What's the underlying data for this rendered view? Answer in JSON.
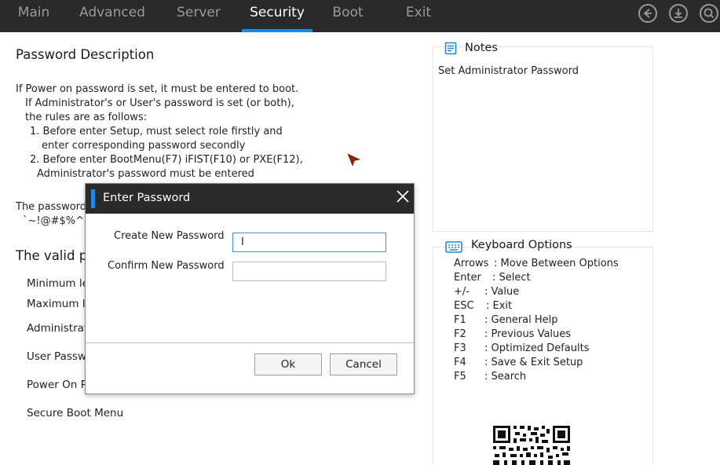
{
  "tabs": [
    {
      "label": "Main"
    },
    {
      "label": "Advanced"
    },
    {
      "label": "Server"
    },
    {
      "label": "Security"
    },
    {
      "label": "Boot"
    },
    {
      "label": "Exit"
    }
  ],
  "active_tab": "Security",
  "top_icons": [
    "back-icon",
    "save-download-icon",
    "search-icon"
  ],
  "left": {
    "heading": "Password Description",
    "description": [
      "If Power on password is set, it must be entered to boot.",
      "If Administrator's or User's password is set (or both),",
      "the rules are as follows:",
      "1. Before enter Setup, must select role firstly and",
      "enter corresponding password secondly",
      "2. Before enter BootMenu(F7) iFIST(F10) or PXE(F12),",
      "Administrator's password must be entered"
    ],
    "password_line_1": "The password",
    "password_line_2": "`~!@#$%^&",
    "valid_heading": "The valid p",
    "items": [
      "Minimum le",
      "Maximum le",
      "Administrat",
      "User Passw",
      "Power On Pa",
      "Secure Boot Menu"
    ]
  },
  "notes": {
    "title": "Notes",
    "text": "Set Administrator Password"
  },
  "keyboard": {
    "title": "Keyboard Options",
    "lines": [
      {
        "key": "Arrows",
        "desc": ": Move Between Options"
      },
      {
        "key": "Enter",
        "desc": ": Select"
      },
      {
        "key": "+/-",
        "desc": ": Value"
      },
      {
        "key": "ESC",
        "desc": ": Exit"
      },
      {
        "key": "F1",
        "desc": ": General Help"
      },
      {
        "key": "F2",
        "desc": ": Previous Values"
      },
      {
        "key": "F3",
        "desc": ": Optimized Defaults"
      },
      {
        "key": "F4",
        "desc": ": Save & Exit Setup"
      },
      {
        "key": "F5",
        "desc": ": Search"
      }
    ]
  },
  "dialog": {
    "title": "Enter Password",
    "create_label": "Create New Password",
    "create_value": "I",
    "confirm_label": "Confirm New Password",
    "confirm_value": "",
    "ok_label": "Ok",
    "cancel_label": "Cancel"
  },
  "colors": {
    "topbar": "#2a2a2a",
    "accent": "#1e88e5",
    "cursor": "#8b2a0f"
  }
}
